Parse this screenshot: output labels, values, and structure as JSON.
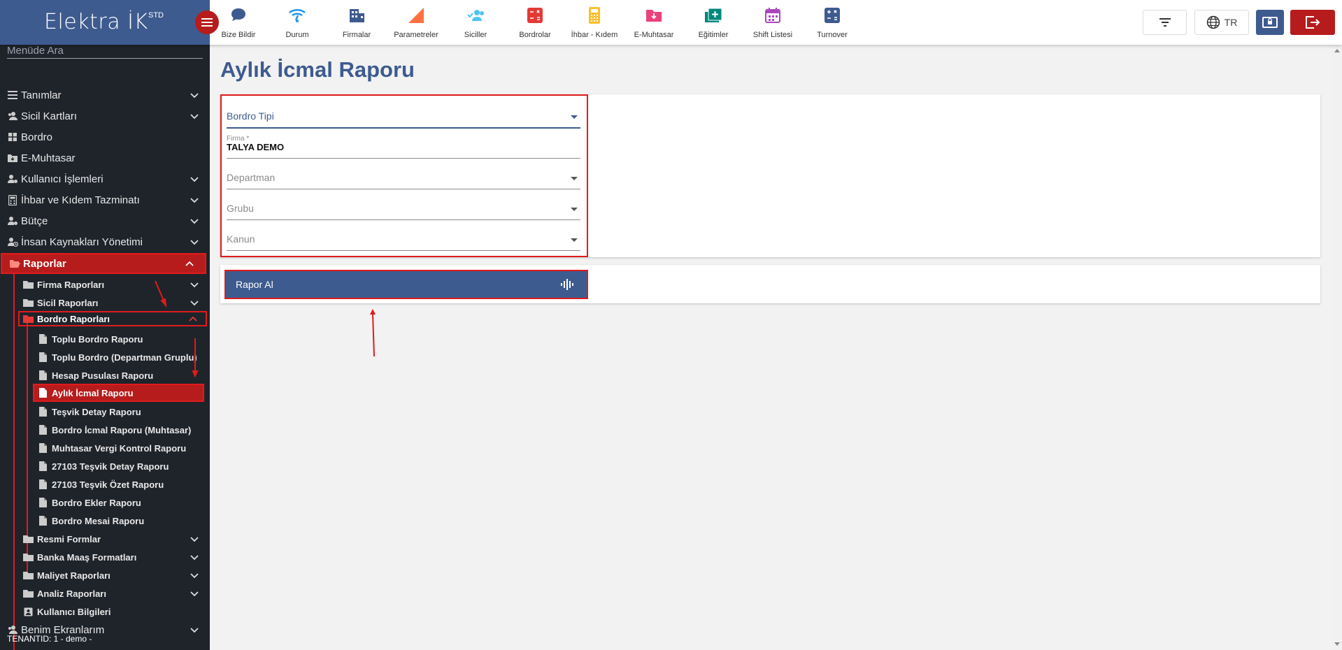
{
  "brand": {
    "title": "Elektra İK",
    "sup": "STD"
  },
  "topnav": [
    {
      "label": "Bize Bildir",
      "icon": "chat-bubble-icon",
      "color": "#3e5b8f"
    },
    {
      "label": "Durum",
      "icon": "wifi-status-icon",
      "color": "#2196f3"
    },
    {
      "label": "Firmalar",
      "icon": "building-icon",
      "color": "#3e5b8f"
    },
    {
      "label": "Parametreler",
      "icon": "triangle-icon",
      "color": "#ff7043"
    },
    {
      "label": "Siciller",
      "icon": "users-check-icon",
      "color": "#4fc3f7"
    },
    {
      "label": "Bordrolar",
      "icon": "calculator-icon",
      "color": "#e53935"
    },
    {
      "label": "İhbar - Kıdem",
      "icon": "calculator-icon",
      "color": "#fbc02d"
    },
    {
      "label": "E-Muhtasar",
      "icon": "folder-download-icon",
      "color": "#ec407a"
    },
    {
      "label": "Eğitimler",
      "icon": "folder-plus-icon",
      "color": "#00897b"
    },
    {
      "label": "Shift Listesi",
      "icon": "calendar-icon",
      "color": "#ab47bc"
    },
    {
      "label": "Turnover",
      "icon": "calculator-icon",
      "color": "#3e5b8f"
    }
  ],
  "toolbar": {
    "lang": "TR"
  },
  "sidebar": {
    "search_placeholder": "Menüde Ara",
    "items": [
      {
        "label": "Tanımlar",
        "icon": "list-icon"
      },
      {
        "label": "Sicil Kartları",
        "icon": "users-icon"
      },
      {
        "label": "Bordro",
        "icon": "grid-icon"
      },
      {
        "label": "E-Muhtasar",
        "icon": "folder-download-icon"
      },
      {
        "label": "Kullanıcı İşlemleri",
        "icon": "user-gear-icon"
      },
      {
        "label": "İhbar ve Kıdem Tazminatı",
        "icon": "calculator-icon"
      },
      {
        "label": "Bütçe",
        "icon": "user-gear-icon"
      },
      {
        "label": "İnsan Kaynakları Yönetimi",
        "icon": "user-clock-icon"
      },
      {
        "label": "Raporlar",
        "icon": "folder-open-icon"
      }
    ],
    "reports_sub": [
      {
        "label": "Firma Raporları"
      },
      {
        "label": "Sicil Raporları"
      },
      {
        "label": "Bordro Raporları"
      }
    ],
    "bordro_reports": [
      "Toplu Bordro Raporu",
      "Toplu Bordro (Departman Gruplu)",
      "Hesap Pusulası Raporu",
      "Aylık İcmal Raporu",
      "Teşvik Detay Raporu",
      "Bordro İcmal Raporu (Muhtasar)",
      "Muhtasar Vergi Kontrol Raporu",
      "27103 Teşvik Detay Raporu",
      "27103 Teşvik Özet Raporu",
      "Bordro Ekler Raporu",
      "Bordro Mesai Raporu"
    ],
    "reports_sub_after": [
      {
        "label": "Resmi Formlar"
      },
      {
        "label": "Banka Maaş Formatları"
      },
      {
        "label": "Maliyet Raporları"
      },
      {
        "label": "Analiz Raporları"
      },
      {
        "label": "Kullanıcı Bilgileri"
      }
    ],
    "bottom_item": "Benim Ekranlarım",
    "tenant": "TENANTID: 1 - demo -"
  },
  "main": {
    "title": "Aylık İcmal Raporu",
    "fields": {
      "bordro_tipi": "Bordro Tipi",
      "firma_label": "Firma *",
      "firma_value": "TALYA DEMO",
      "departman": "Departman",
      "grubu": "Grubu",
      "kanun": "Kanun"
    },
    "report_button": "Rapor Al"
  },
  "colors": {
    "primary": "#3e5b8f",
    "danger": "#b71c1c",
    "highlight": "#e01b1b",
    "sidebar": "#1f242b"
  }
}
